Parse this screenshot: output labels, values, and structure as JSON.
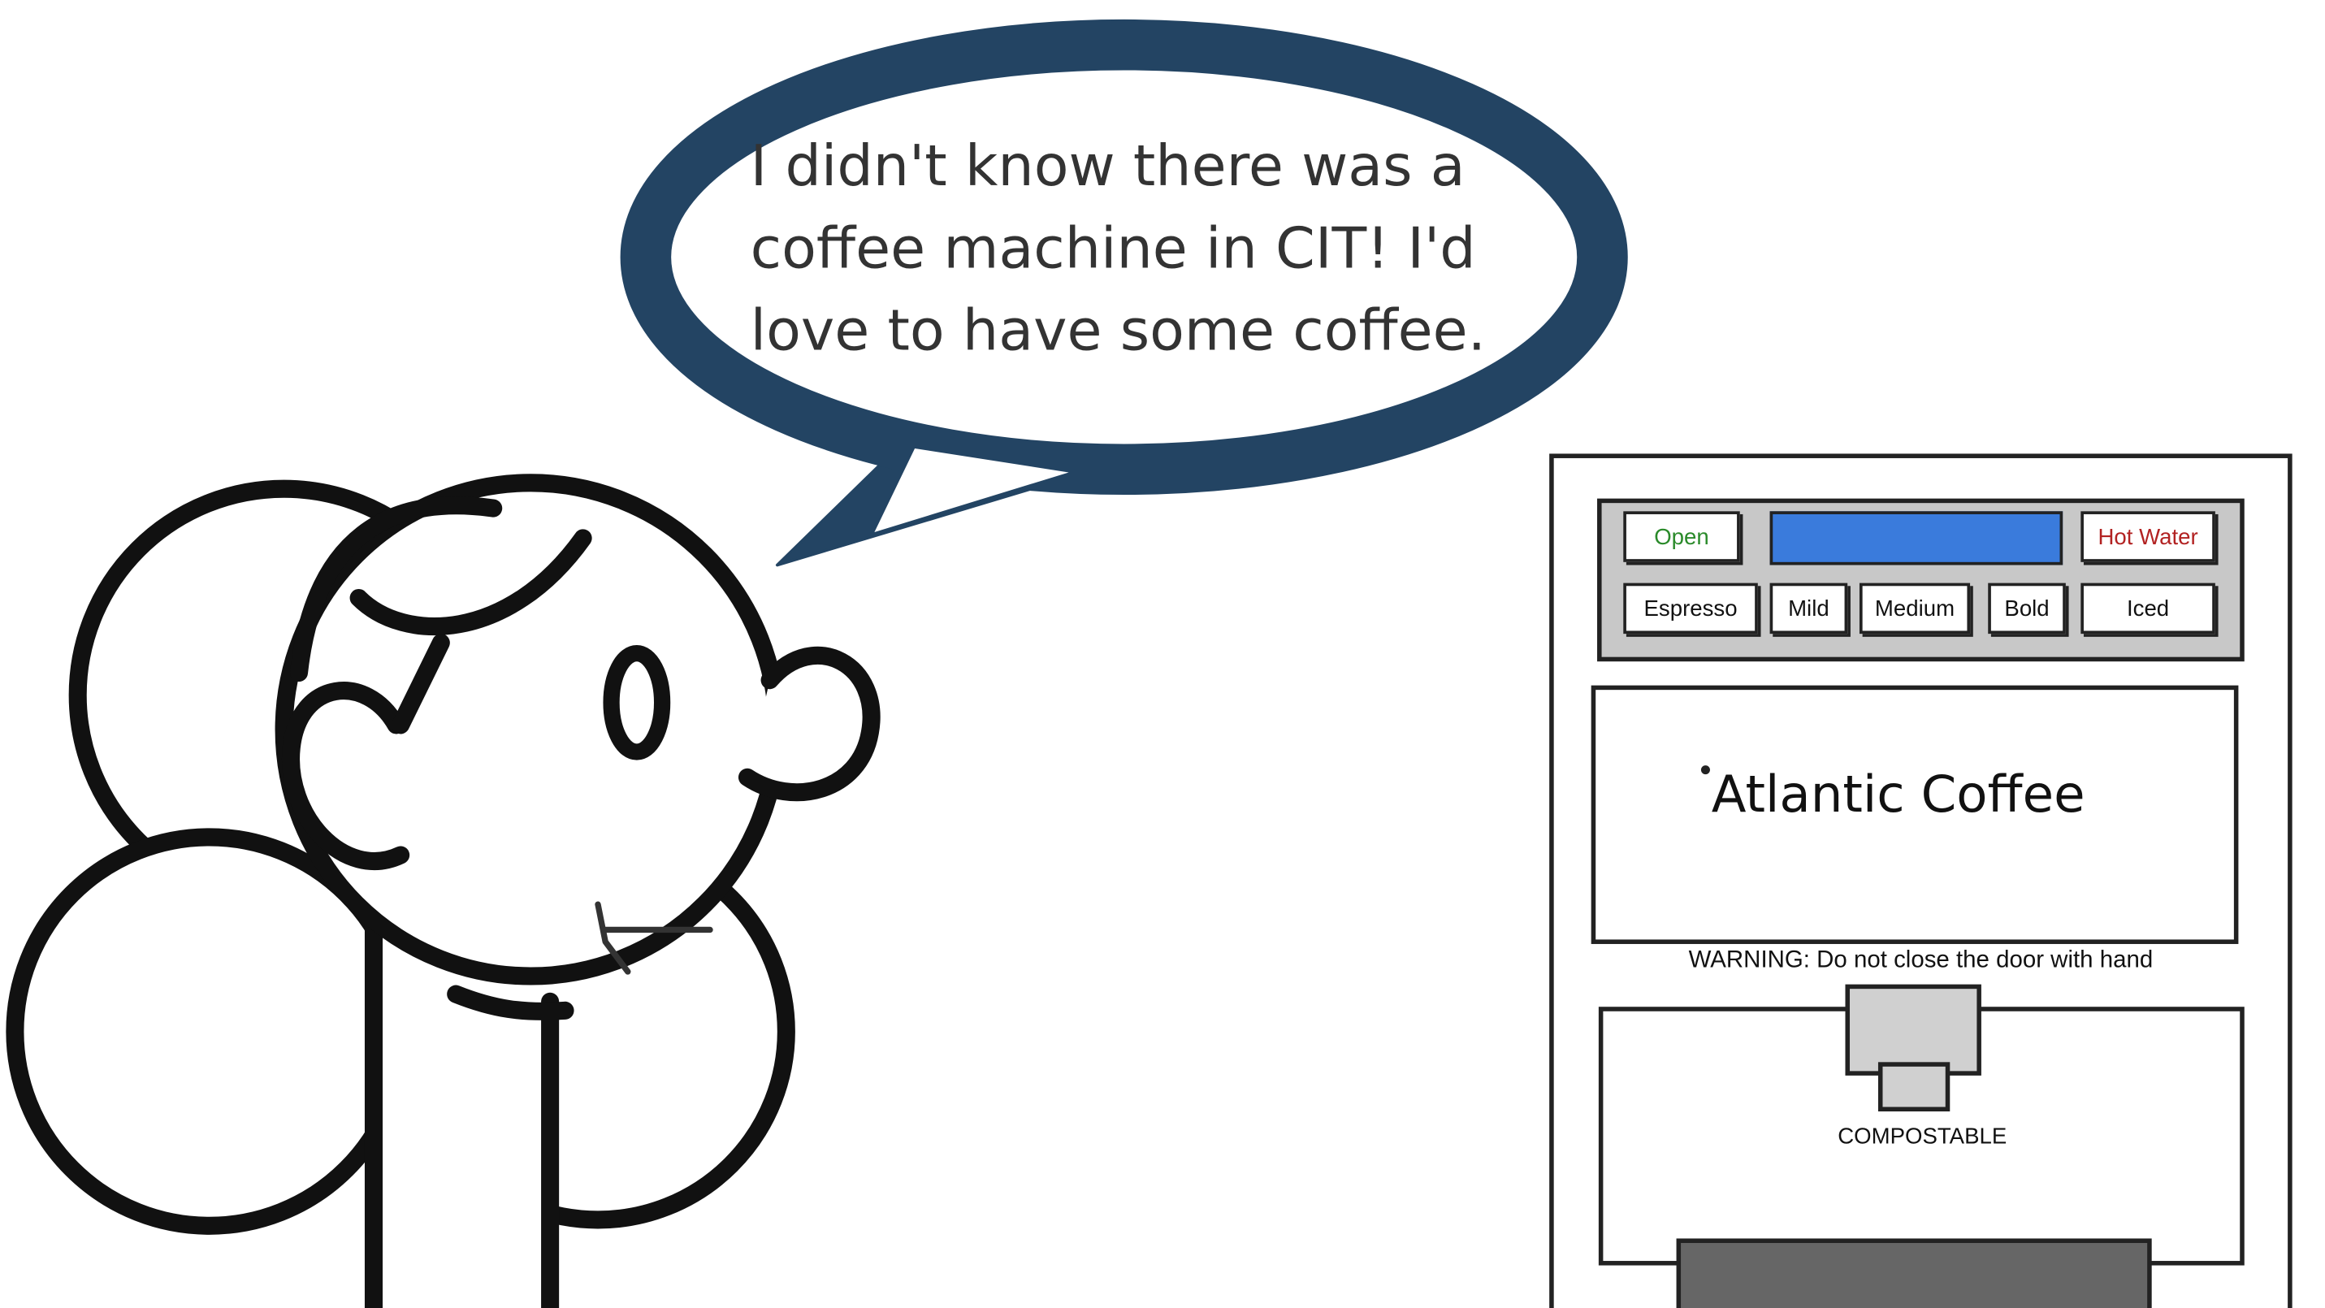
{
  "speech": {
    "lines": [
      "I didn't know there was a",
      "coffee machine in CIT! I'd",
      "love to have some coffee."
    ],
    "bubble_color": "#234463"
  },
  "machine": {
    "buttons": {
      "open": "Open",
      "hot_water": "Hot Water",
      "espresso": "Espresso",
      "mild": "Mild",
      "medium": "Medium",
      "bold": "Bold",
      "iced": "Iced"
    },
    "button_colors": {
      "open": "#2a8a2a",
      "hot_water": "#b22222"
    },
    "display_color": "#3a7bdc",
    "brand": "Atlantic Coffee",
    "warning": "WARNING: Do not close the door with hand",
    "cup_label": "COMPOSTABLE"
  }
}
